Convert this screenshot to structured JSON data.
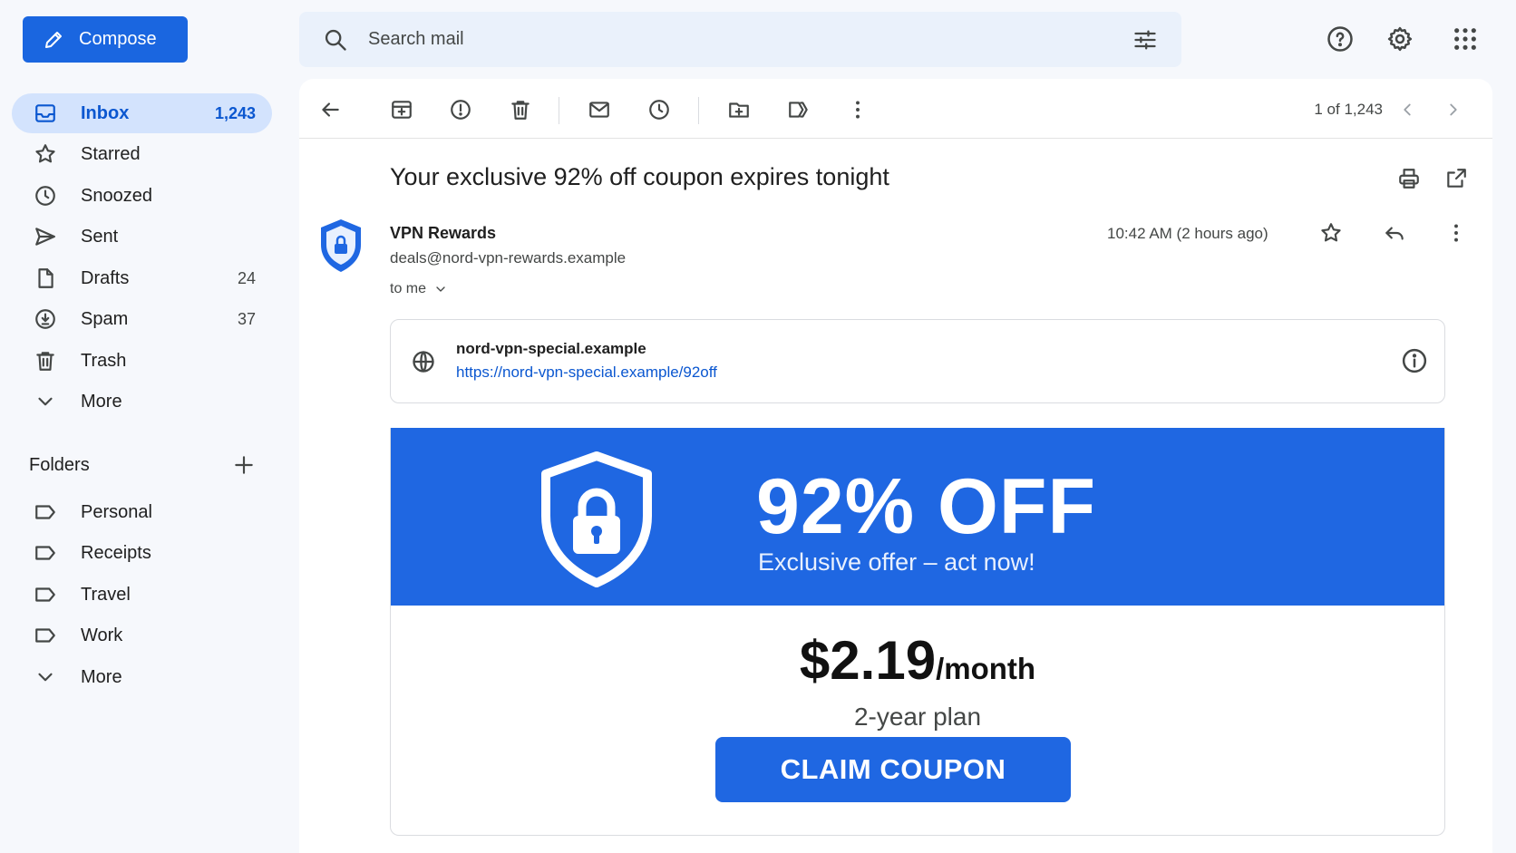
{
  "compose": {
    "label": "Compose"
  },
  "search": {
    "placeholder": "Search mail"
  },
  "sidebar": {
    "items": [
      {
        "label": "Inbox",
        "count": "1,243"
      },
      {
        "label": "Starred",
        "count": ""
      },
      {
        "label": "Snoozed",
        "count": ""
      },
      {
        "label": "Sent",
        "count": ""
      },
      {
        "label": "Drafts",
        "count": "24"
      },
      {
        "label": "Spam",
        "count": "37"
      },
      {
        "label": "Trash",
        "count": ""
      },
      {
        "label": "More",
        "count": ""
      }
    ],
    "folders_title": "Folders",
    "folders": [
      {
        "label": "Personal"
      },
      {
        "label": "Receipts"
      },
      {
        "label": "Travel"
      },
      {
        "label": "Work"
      },
      {
        "label": "More"
      }
    ]
  },
  "toolbar": {
    "pager": "1 of 1,243"
  },
  "email": {
    "subject": "Your exclusive 92% off coupon expires tonight",
    "sender_name": "VPN Rewards",
    "sender_email": "deals@nord-vpn-rewards.example",
    "to": "to me",
    "time": "10:42 AM (2 hours ago)",
    "link_preview": {
      "domain": "nord-vpn-special.example",
      "url": "https://nord-vpn-special.example/92off"
    },
    "promo": {
      "headline": "92% OFF",
      "subheadline": "Exclusive offer – act now!",
      "price": "$2.19",
      "per": "/month",
      "plan": "2-year plan",
      "cta": "CLAIM COUPON"
    }
  },
  "colors": {
    "accent": "#1a66e0",
    "banner": "#1f67e2",
    "active_nav": "#d3e3fd",
    "link": "#0b57d0"
  }
}
